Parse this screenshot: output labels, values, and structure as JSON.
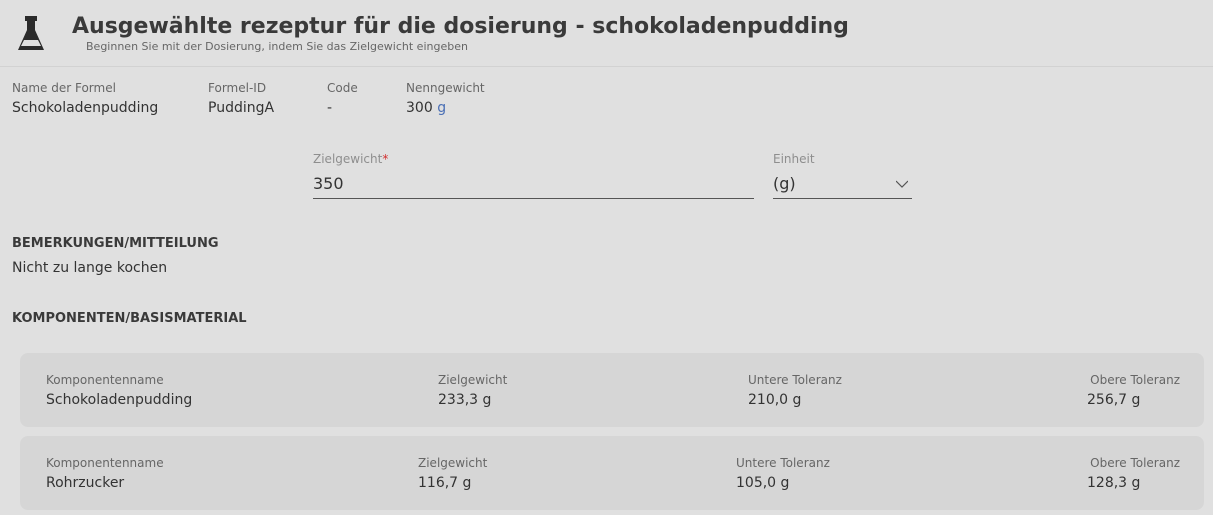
{
  "header": {
    "title": "Ausgewählte rezeptur für die dosierung - schokoladenpudding",
    "subtitle": "Beginnen Sie mit der Dosierung, indem Sie das Zielgewicht eingeben",
    "icon": "flask-icon"
  },
  "formula": {
    "name_label": "Name der Formel",
    "name_value": "Schokoladenpudding",
    "id_label": "Formel-ID",
    "id_value": "PuddingA",
    "code_label": "Code",
    "code_value": "-",
    "nominal_label": "Nenngewicht",
    "nominal_value": "300",
    "nominal_unit": "g"
  },
  "form": {
    "target_label": "Zielgewicht",
    "target_required_mark": "*",
    "target_value": "350",
    "unit_label": "Einheit",
    "unit_value": "(g)"
  },
  "remarks": {
    "title": "BEMERKUNGEN/MITTEILUNG",
    "text": "Nicht zu lange kochen"
  },
  "components": {
    "title": "KOMPONENTEN/BASISMATERIAL",
    "items": [
      {
        "name_label": "Komponentenname",
        "name": "Schokoladenpudding",
        "target_label": "Zielgewicht",
        "target": "233,3 g",
        "lower_label": "Untere Toleranz",
        "lower": "210,0 g",
        "upper_label": "Obere Toleranz",
        "upper": "256,7 g"
      },
      {
        "name_label": "Komponentenname",
        "name": "Rohrzucker",
        "target_label": "Zielgewicht",
        "target": "116,7 g",
        "lower_label": "Untere Toleranz",
        "lower": "105,0 g",
        "upper_label": "Obere Toleranz",
        "upper": "128,3 g"
      }
    ]
  },
  "colors": {
    "background": "#e0e0e0",
    "card": "#d6d6d6",
    "unit_accent": "#4a6fb5",
    "required": "#d32f2f"
  }
}
